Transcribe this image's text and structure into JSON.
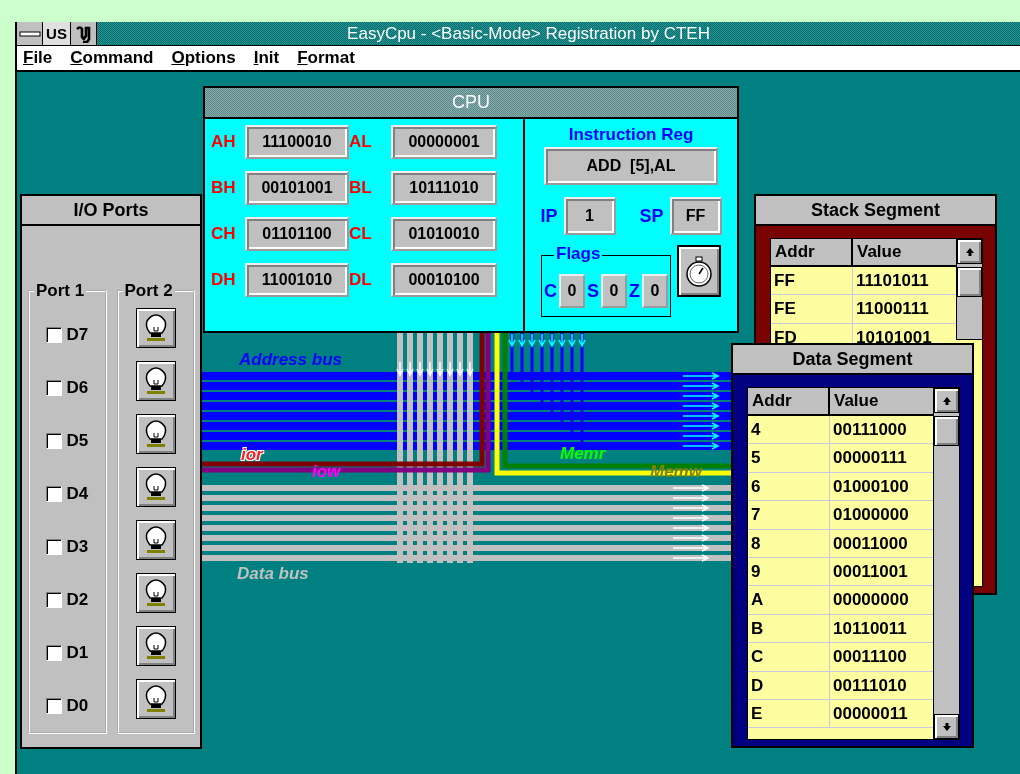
{
  "window": {
    "title": "EasyCpu -  <Basic-Mode>  Registration by CTEH",
    "badge": "US"
  },
  "menu": [
    {
      "label": "File"
    },
    {
      "label": "Command"
    },
    {
      "label": "Options"
    },
    {
      "label": "Init"
    },
    {
      "label": "Format"
    }
  ],
  "cpu": {
    "title": "CPU",
    "registers": [
      {
        "name": "AH",
        "value": "11100010"
      },
      {
        "name": "AL",
        "value": "00000001"
      },
      {
        "name": "BH",
        "value": "00101001"
      },
      {
        "name": "BL",
        "value": "10111010"
      },
      {
        "name": "CH",
        "value": "01101100"
      },
      {
        "name": "CL",
        "value": "01010010"
      },
      {
        "name": "DH",
        "value": "11001010"
      },
      {
        "name": "DL",
        "value": "00010100"
      }
    ],
    "instruction_reg": {
      "label": "Instruction Reg",
      "value": "ADD  [5],AL"
    },
    "ip": {
      "label": "IP",
      "value": "1"
    },
    "sp": {
      "label": "SP",
      "value": "FF"
    },
    "flags": {
      "title": "Flags",
      "items": [
        {
          "name": "C",
          "value": "0"
        },
        {
          "name": "S",
          "value": "0"
        },
        {
          "name": "Z",
          "value": "0"
        }
      ]
    }
  },
  "buses": [
    {
      "kind": "address",
      "label": "Address bus"
    },
    {
      "kind": "ior",
      "label": "ior"
    },
    {
      "kind": "iow",
      "label": "iow"
    },
    {
      "kind": "memr",
      "label": "Memr"
    },
    {
      "kind": "memw",
      "label": "Memw"
    },
    {
      "kind": "data",
      "label": "Data bus"
    }
  ],
  "io_ports": {
    "title": "I/O Ports",
    "port1": {
      "title": "Port 1",
      "bits": [
        {
          "label": "D7",
          "checked": false
        },
        {
          "label": "D6",
          "checked": false
        },
        {
          "label": "D5",
          "checked": false
        },
        {
          "label": "D4",
          "checked": false
        },
        {
          "label": "D3",
          "checked": false
        },
        {
          "label": "D2",
          "checked": false
        },
        {
          "label": "D1",
          "checked": false
        },
        {
          "label": "D0",
          "checked": false
        }
      ]
    },
    "port2": {
      "title": "Port 2",
      "lamps": [
        {
          "on": false
        },
        {
          "on": false
        },
        {
          "on": false
        },
        {
          "on": false
        },
        {
          "on": false
        },
        {
          "on": false
        },
        {
          "on": false
        },
        {
          "on": false
        }
      ]
    }
  },
  "stack_segment": {
    "title": "Stack Segment",
    "columns": [
      "Addr",
      "Value"
    ],
    "rows": [
      [
        "FF",
        "11101011"
      ],
      [
        "FE",
        "11000111"
      ],
      [
        "FD",
        "10101001"
      ]
    ]
  },
  "data_segment": {
    "title": "Data Segment",
    "columns": [
      "Addr",
      "Value"
    ],
    "rows": [
      [
        "4",
        "00111000"
      ],
      [
        "5",
        "00000111"
      ],
      [
        "6",
        "01000100"
      ],
      [
        "7",
        "01000000"
      ],
      [
        "8",
        "00011000"
      ],
      [
        "9",
        "00011001"
      ],
      [
        "A",
        "00000000"
      ],
      [
        "B",
        "10110011"
      ],
      [
        "C",
        "00011100"
      ],
      [
        "D",
        "00111010"
      ],
      [
        "E",
        "00000011"
      ]
    ]
  }
}
